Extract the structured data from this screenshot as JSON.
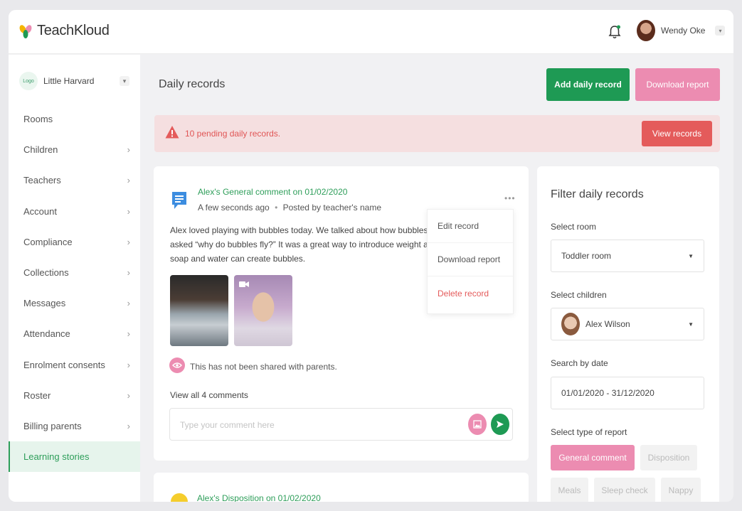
{
  "app": {
    "logo_text": "TeachKloud"
  },
  "user": {
    "name": "Wendy Oke"
  },
  "sidebar": {
    "school_logo": "Logo",
    "school_name": "Little Harvard",
    "items": [
      {
        "label": "Rooms",
        "chevron": false
      },
      {
        "label": "Children",
        "chevron": true
      },
      {
        "label": "Teachers",
        "chevron": true
      },
      {
        "label": "Account",
        "chevron": true
      },
      {
        "label": "Compliance",
        "chevron": true
      },
      {
        "label": "Collections",
        "chevron": true
      },
      {
        "label": "Messages",
        "chevron": true
      },
      {
        "label": "Attendance",
        "chevron": true
      },
      {
        "label": "Enrolment consents",
        "chevron": true
      },
      {
        "label": "Roster",
        "chevron": true
      },
      {
        "label": "Billing parents",
        "chevron": true
      },
      {
        "label": "Learning stories",
        "chevron": false,
        "active": true
      }
    ]
  },
  "header": {
    "title": "Daily records",
    "add_label": "Add daily record",
    "download_label": "Download report"
  },
  "alert": {
    "text": "10 pending daily records.",
    "button": "View records"
  },
  "post": {
    "title": "Alex's General comment on 01/02/2020",
    "time": "A few seconds ago",
    "posted_by": "Posted by teacher's name",
    "body_lines": [
      "Alex loved playing with bubbles today. We talked about how bubbles c",
      "asked “why do bubbles fly?” It was a great way to introduce weight an",
      "soap and water can create bubbles."
    ],
    "share_text": "This has not been shared with parents.",
    "comments_link": "View all 4 comments",
    "comment_placeholder": "Type your comment here"
  },
  "menu": {
    "edit": "Edit record",
    "download": "Download report",
    "delete": "Delete record"
  },
  "post2": {
    "title": "Alex's Disposition on 01/02/2020"
  },
  "filter": {
    "title": "Filter daily records",
    "room_label": "Select room",
    "room_value": "Toddler room",
    "children_label": "Select children",
    "children_value": "Alex Wilson",
    "date_label": "Search by date",
    "date_value": "01/01/2020 - 31/12/2020",
    "type_label": "Select type of report",
    "types": [
      "General comment",
      "Disposition",
      "Meals",
      "Sleep check",
      "Nappy"
    ]
  },
  "colors": {
    "primary": "#1e9a54",
    "pink": "#ec8cb1",
    "danger": "#e45b5b",
    "alert_bg": "#f5dfe0"
  }
}
